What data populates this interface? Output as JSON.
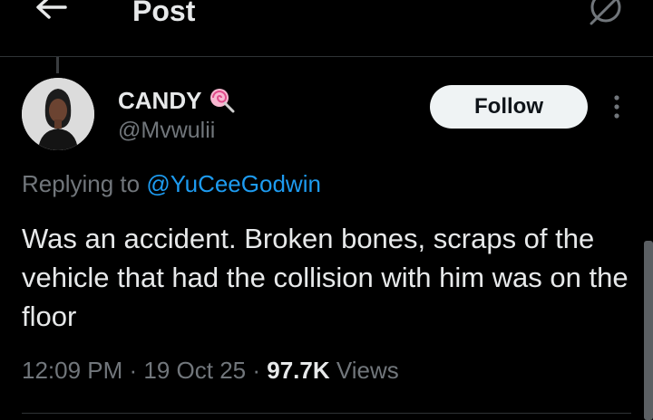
{
  "header": {
    "title": "Post",
    "back_icon": "arrow-left-icon",
    "action_icon": "grok-icon"
  },
  "author": {
    "name": "CANDY",
    "handle": "@Mvwulii",
    "badge_icon": "lollipop-emoji-icon",
    "avatar": "avatar"
  },
  "follow_button": {
    "label": "Follow"
  },
  "more_icon": "more-vertical-icon",
  "reply": {
    "prefix": "Replying to ",
    "handle": "@YuCeeGodwin"
  },
  "tweet": {
    "text": "Was an accident. Broken bones, scraps of the vehicle that had the collision with him was on the floor"
  },
  "meta": {
    "time": "12:09 PM",
    "date": "19 Oct 25",
    "separator": " · ",
    "views_count": "97.7K",
    "views_label": " Views"
  },
  "colors": {
    "background": "#000000",
    "text": "#e7e9ea",
    "muted": "#71767b",
    "link": "#1d9bf0",
    "button": "#eff3f4"
  }
}
